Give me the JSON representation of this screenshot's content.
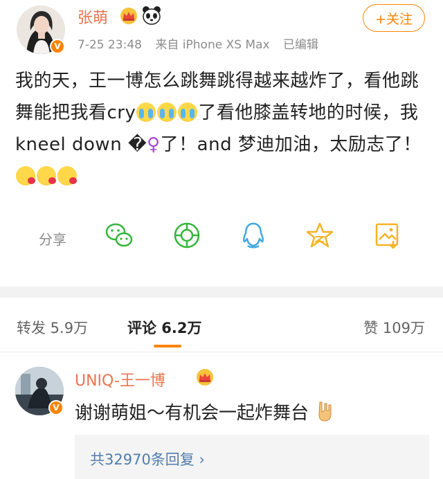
{
  "post": {
    "author_name": "张萌",
    "timestamp": "7-25 23:48",
    "source": "来自 iPhone XS Max",
    "edited": "已编辑",
    "follow_label": "+关注",
    "text": {
      "seg1": "我的天，王一博怎么跳舞跳得越来越炸了，看他跳舞能把我看cry",
      "seg2": "了看他膝盖转地的时候，我kneel down ",
      "glyph": "�",
      "venus": "♀",
      "seg3": "了！and 梦迪加油，太励志了！"
    },
    "emoji": [
      "crying-emoji",
      "crying-emoji",
      "crying-emoji",
      "blowing-kiss-emoji",
      "blowing-kiss-emoji",
      "blowing-kiss-emoji"
    ]
  },
  "actions": {
    "share_label": "分享",
    "icons": [
      "wechat-icon",
      "moments-icon",
      "qq-icon",
      "qzone-star-icon",
      "save-image-icon"
    ]
  },
  "tabs": {
    "repost": "转发 5.9万",
    "comments": "评论 6.2万",
    "likes": "赞 109万"
  },
  "comment": {
    "user": "UNIQ-王一博",
    "text": "谢谢萌姐～有机会一起炸舞台",
    "replies_link": "共32970条回复 ›"
  },
  "colors": {
    "accent": "#ff8200",
    "username": "#eb7350",
    "link": "#507daf",
    "action_green": "#34b53a",
    "action_blue": "#41a8e0",
    "action_gold": "#f5b324"
  }
}
